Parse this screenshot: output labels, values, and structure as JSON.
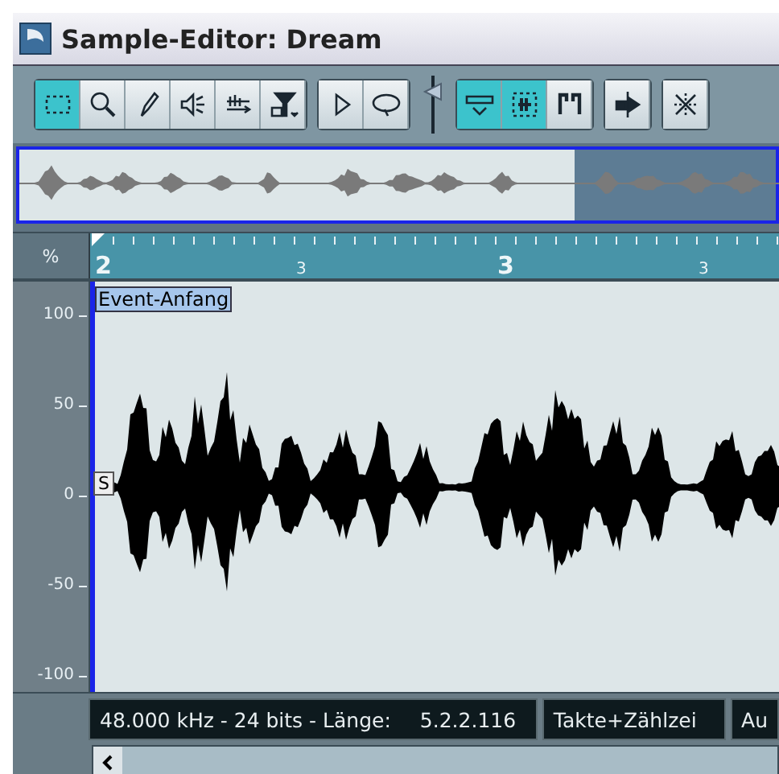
{
  "window": {
    "title": "Sample-Editor: Dream"
  },
  "toolbar": {
    "groups": [
      {
        "tools": [
          {
            "kind": "range",
            "selected": true
          },
          {
            "kind": "zoom",
            "selected": false
          },
          {
            "kind": "pencil",
            "selected": false
          },
          {
            "kind": "speaker",
            "selected": false
          },
          {
            "kind": "scrub",
            "selected": false
          },
          {
            "kind": "snap",
            "selected": false
          }
        ]
      },
      {
        "tools": [
          {
            "kind": "play",
            "selected": false
          },
          {
            "kind": "loop",
            "selected": false
          }
        ]
      },
      {
        "tools": [
          {
            "kind": "hitpoints",
            "selected": true
          },
          {
            "kind": "region",
            "selected": true
          },
          {
            "kind": "brackets",
            "selected": false
          }
        ]
      },
      {
        "tools": [
          {
            "kind": "split",
            "selected": false
          }
        ]
      },
      {
        "tools": [
          {
            "kind": "crossfade",
            "selected": false
          }
        ]
      }
    ]
  },
  "ruler": {
    "unit": "%",
    "labels": [
      {
        "text": "2",
        "kind": "major"
      },
      {
        "text": "3",
        "kind": "minor"
      },
      {
        "text": "3",
        "kind": "major"
      },
      {
        "text": "3",
        "kind": "minor"
      }
    ]
  },
  "axis": {
    "labels": [
      "100",
      "50",
      "0",
      "-50",
      "-100"
    ]
  },
  "event_start_label": "Event-Anfang",
  "sync_marker": "S",
  "status_bar": {
    "info": "48.000 kHz - 24 bits - Länge:",
    "length": "5.2.2.116",
    "display_format": "Takte+Zählzei",
    "field_3": "Au"
  }
}
